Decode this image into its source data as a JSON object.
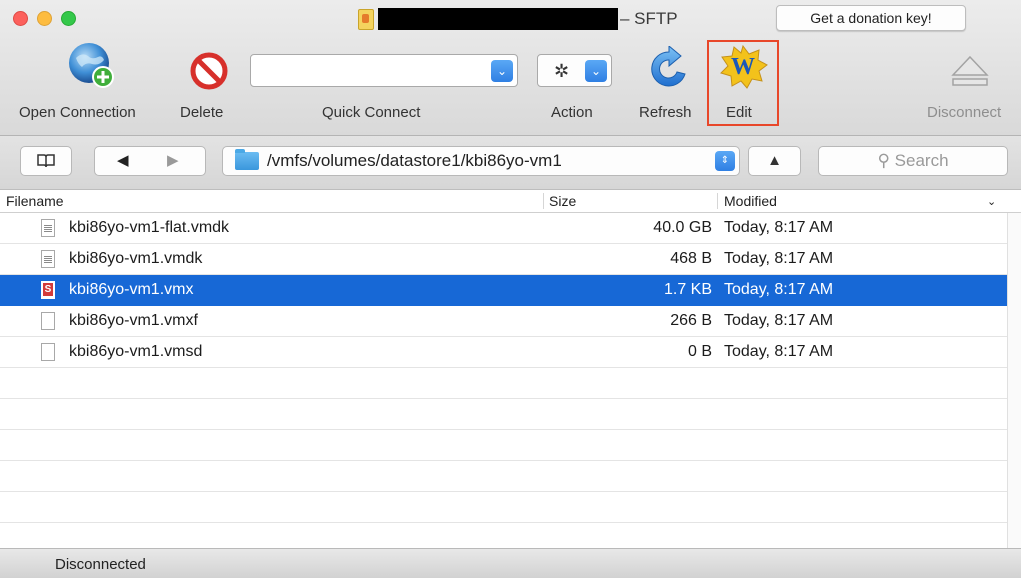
{
  "window": {
    "title_suffix": "– SFTP",
    "donation_button": "Get a donation key!"
  },
  "toolbar": {
    "open_connection": "Open Connection",
    "delete": "Delete",
    "quick_connect": "Quick Connect",
    "quick_connect_value": "",
    "action": "Action",
    "refresh": "Refresh",
    "edit": "Edit",
    "disconnect": "Disconnect"
  },
  "pathbar": {
    "path": "/vmfs/volumes/datastore1/kbi86yo-vm1",
    "search_placeholder": "Search",
    "back_glyph": "◀",
    "forward_glyph": "▶",
    "up_glyph": "▲"
  },
  "table": {
    "columns": [
      "Filename",
      "Size",
      "Modified"
    ],
    "rows": [
      {
        "name": "kbi86yo-vm1-flat.vmdk",
        "size": "40.0 GB",
        "modified": "Today, 8:17 AM",
        "icon": "text-document-icon"
      },
      {
        "name": "kbi86yo-vm1.vmdk",
        "size": "468 B",
        "modified": "Today, 8:17 AM",
        "icon": "text-document-icon"
      },
      {
        "name": "kbi86yo-vm1.vmx",
        "size": "1.7 KB",
        "modified": "Today, 8:17 AM",
        "icon": "script-document-icon",
        "selected": true
      },
      {
        "name": "kbi86yo-vm1.vmxf",
        "size": "266 B",
        "modified": "Today, 8:17 AM",
        "icon": "blank-document-icon"
      },
      {
        "name": "kbi86yo-vm1.vmsd",
        "size": "0 B",
        "modified": "Today, 8:17 AM",
        "icon": "blank-document-icon"
      }
    ]
  },
  "status": {
    "text": "Disconnected"
  },
  "colors": {
    "selection": "#1768d6",
    "accent_blue": "#2f7fe3",
    "highlight_box": "#e8472a"
  }
}
